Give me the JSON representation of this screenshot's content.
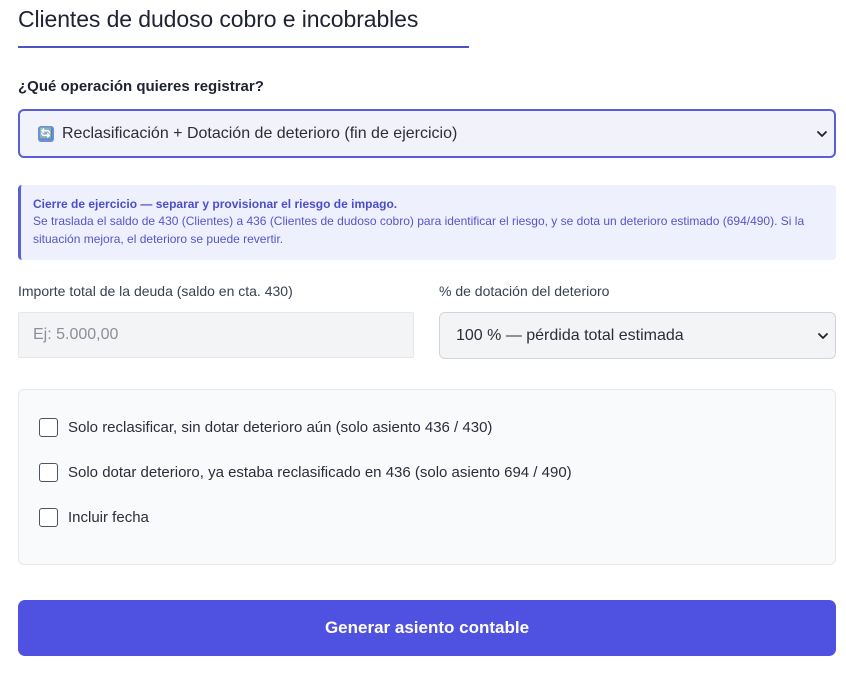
{
  "header": {
    "title": "Clientes de dudoso cobro e incobrables"
  },
  "operation": {
    "label": "¿Qué operación quieres registrar?",
    "selected_icon": "counterclockwise-arrows-icon",
    "selected": "Reclasificación + Dotación de deterioro (fin de ejercicio)"
  },
  "info": {
    "title": "Cierre de ejercicio — separar y provisionar el riesgo de impago.",
    "text": "Se traslada el saldo de 430 (Clientes) a 436 (Clientes de dudoso cobro) para identificar el riesgo, y se dota un deterioro estimado (694/490). Si la situación mejora, el deterioro se puede revertir."
  },
  "amount": {
    "label": "Importe total de la deuda (saldo en cta. 430)",
    "value": "",
    "placeholder": "Ej: 5.000,00"
  },
  "percentage": {
    "label": "% de dotación del deterioro",
    "selected": "100 % — pérdida total estimada"
  },
  "options": [
    {
      "label": "Solo reclasificar, sin dotar deterioro aún (solo asiento 436 / 430)",
      "checked": false
    },
    {
      "label": "Solo dotar deterioro, ya estaba reclasificado en 436 (solo asiento 694 / 490)",
      "checked": false
    },
    {
      "label": "Incluir fecha",
      "checked": false
    }
  ],
  "submit": {
    "label": "Generar asiento contable"
  },
  "colors": {
    "accent": "#4f51e0",
    "info_bg": "#eef0fd",
    "info_text": "#5356c9"
  }
}
